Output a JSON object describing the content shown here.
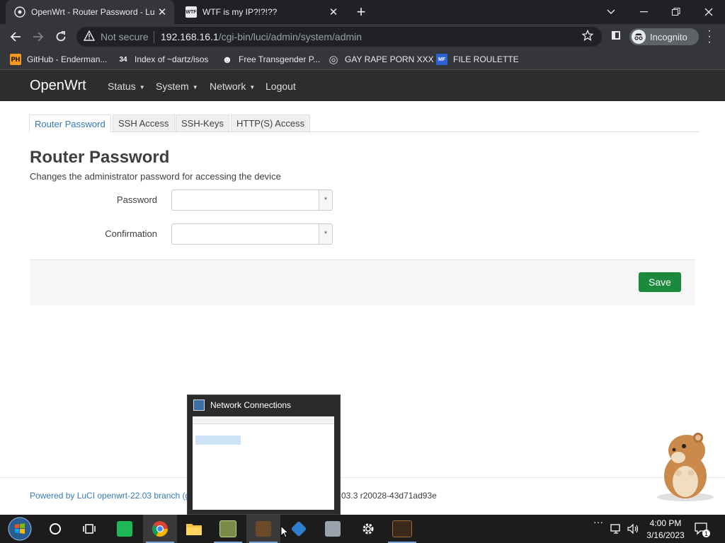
{
  "browser": {
    "tabs": [
      {
        "title": "OpenWrt - Router Password - Lu"
      },
      {
        "title": "WTF is my IP?!?!??",
        "favicon_text": "WTF"
      }
    ],
    "new_tab": "+",
    "window_controls": {
      "chevron": "⌄",
      "minimize": "—",
      "restore": "❐",
      "close": "✕"
    },
    "security_label": "Not secure",
    "url_host": "192.168.16.1",
    "url_path": "/cgi-bin/luci/admin/system/admin",
    "incognito_label": "Incognito",
    "bookmarks": [
      {
        "label": "GitHub - Enderman...",
        "icon_text": "PH",
        "icon_color": "#f7971e"
      },
      {
        "label": "Index of ~dartz/isos",
        "icon_text": "34",
        "icon_color": "#ffffff"
      },
      {
        "label": "Free Transgender P...",
        "icon_text": "☻",
        "icon_color": "#ffffff"
      },
      {
        "label": "GAY RAPE PORN XXX",
        "icon_text": "◎",
        "icon_color": "#dddddd"
      },
      {
        "label": "FILE ROULETTE",
        "icon_text": "MF",
        "icon_color": "#2f62d8"
      }
    ]
  },
  "luci": {
    "brand": "OpenWrt",
    "menu": [
      "Status",
      "System",
      "Network",
      "Logout"
    ],
    "tabs": [
      "Router Password",
      "SSH Access",
      "SSH-Keys",
      "HTTP(S) Access"
    ],
    "active_tab_index": 0,
    "page_title": "Router Password",
    "page_description": "Changes the administrator password for accessing the device",
    "fields": [
      {
        "label": "Password",
        "value": "",
        "reveal_glyph": "*"
      },
      {
        "label": "Confirmation",
        "value": "",
        "reveal_glyph": "*"
      }
    ],
    "save_label": "Save",
    "footer_left": "Powered by LuCI openwrt-22.03 branch (gi",
    "footer_right": "2.03.3 r20028-43d71ad93e"
  },
  "taskbar": {
    "preview_title": "Network Connections",
    "time": "4:00 PM",
    "date": "3/16/2023",
    "notification_count": "1"
  },
  "colors": {
    "chrome_dark": "#202124",
    "chrome_toolbar": "#35363a",
    "openwrt_header": "#2d2d2d",
    "link_blue": "#337ab7",
    "save_green": "#1b8a3c"
  }
}
